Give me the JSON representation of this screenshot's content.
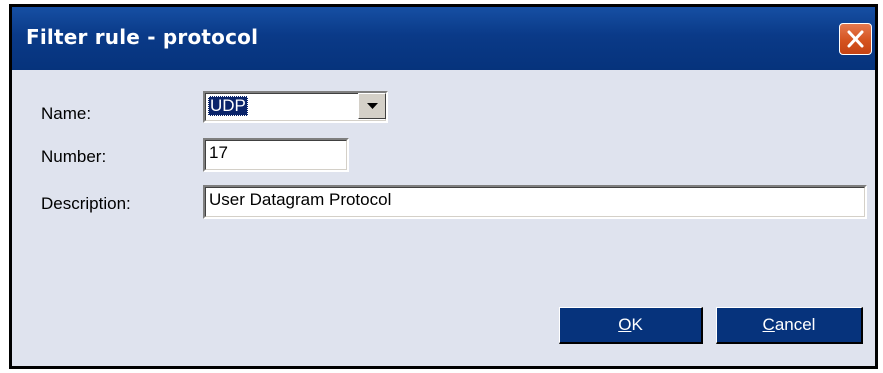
{
  "window": {
    "title": "Filter rule - protocol"
  },
  "form": {
    "name_label": "Name:",
    "name_value": "UDP",
    "number_label": "Number:",
    "number_value": "17",
    "description_label": "Description:",
    "description_value": "User Datagram Protocol"
  },
  "buttons": {
    "ok_access": "O",
    "ok_rest": "K",
    "cancel_access": "C",
    "cancel_rest": "ancel"
  },
  "icons": {
    "close": "close-icon",
    "dropdown": "chevron-down-icon"
  },
  "colors": {
    "titlebar": "#0a3a88",
    "dialog_background": "#dfe3ee",
    "button_background": "#06337c",
    "close_button": "#d5531f",
    "selection": "#0a246a"
  }
}
